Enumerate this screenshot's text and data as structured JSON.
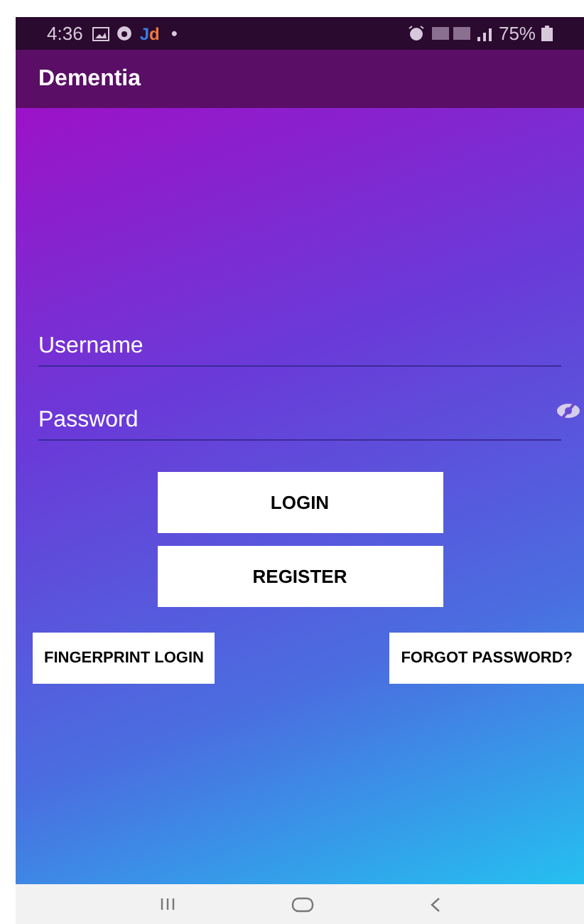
{
  "status_bar": {
    "time": "4:36",
    "carrier_badge": "Jd",
    "dot": "•",
    "battery": "75%"
  },
  "app_bar": {
    "title": "Dementia"
  },
  "form": {
    "username": {
      "placeholder": "Username"
    },
    "password": {
      "placeholder": "Password"
    }
  },
  "buttons": [
    {
      "label": "LOGIN",
      "kind": "primary"
    },
    {
      "label": "REGISTER",
      "kind": "primary"
    },
    {
      "label": "FINGERPRINT LOGIN",
      "kind": "secondary"
    },
    {
      "label": "FORGOT PASSWORD?",
      "kind": "secondary"
    }
  ]
}
